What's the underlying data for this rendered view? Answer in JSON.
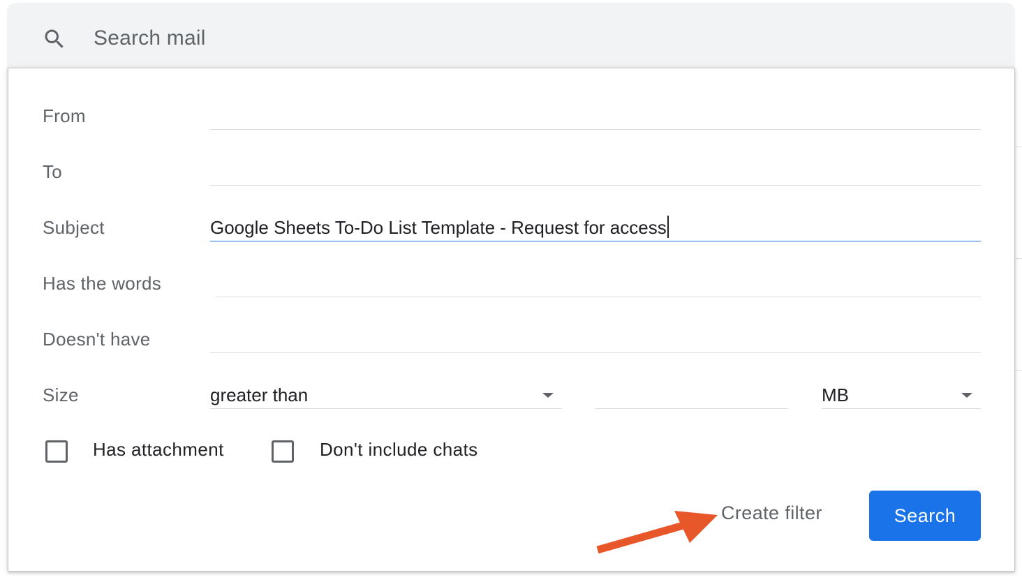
{
  "search": {
    "placeholder": "Search mail"
  },
  "filter_form": {
    "from_label": "From",
    "from_value": "",
    "to_label": "To",
    "to_value": "",
    "subject_label": "Subject",
    "subject_value": "Google Sheets To-Do List Template - Request for access",
    "has_words_label": "Has the words",
    "has_words_value": "",
    "doesnt_have_label": "Doesn't have",
    "doesnt_have_value": "",
    "size_label": "Size",
    "size_operator": "greater than",
    "size_value": "",
    "size_unit": "MB",
    "has_attachment_label": "Has attachment",
    "has_attachment_checked": false,
    "dont_include_chats_label": "Don't include chats",
    "dont_include_chats_checked": false,
    "create_filter_label": "Create filter",
    "search_button_label": "Search"
  },
  "colors": {
    "accent": "#1a73e8",
    "annotation_arrow": "#e8572a",
    "searchbar_bg": "#f1f3f4"
  },
  "icons": {
    "search": "search-icon",
    "dropdown": "chevron-down-icon",
    "annotation": "arrow-annotation-icon"
  }
}
